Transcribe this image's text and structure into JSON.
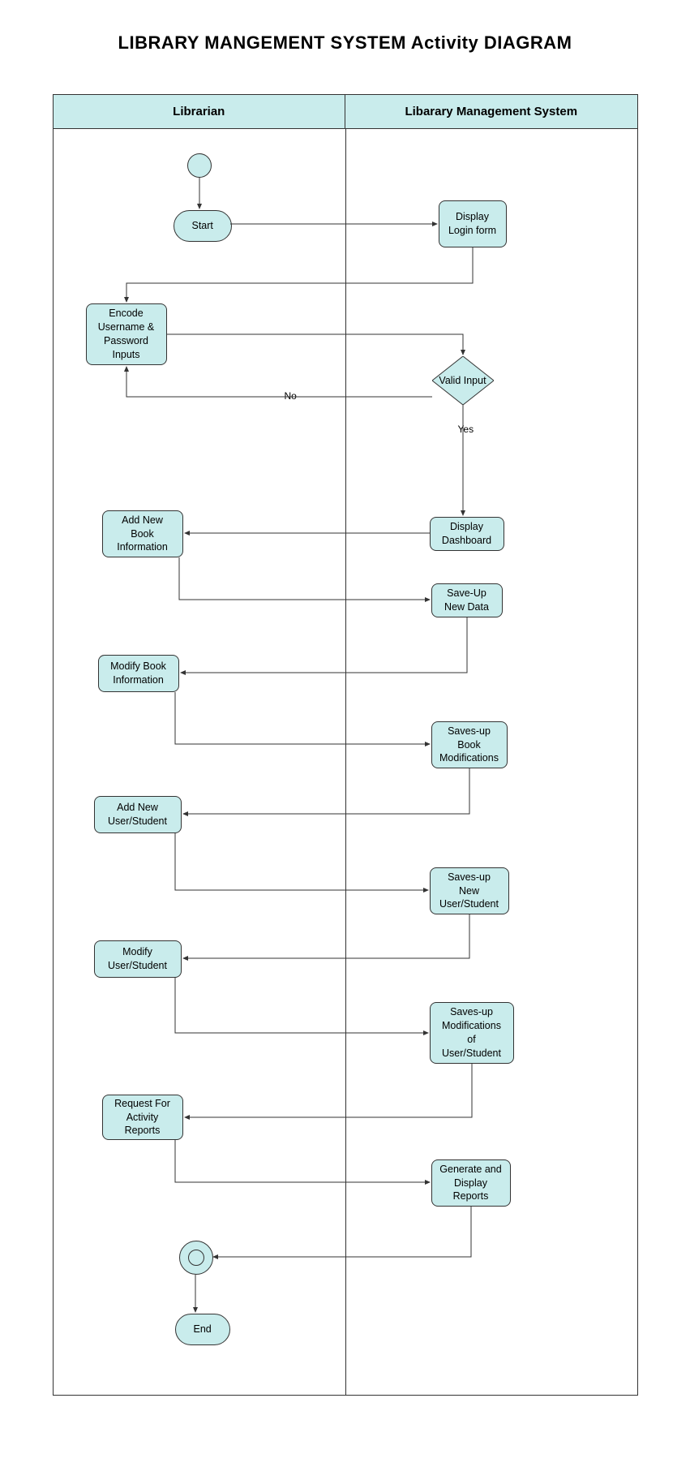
{
  "title": "LIBRARY MANGEMENT SYSTEM Activity DIAGRAM",
  "lanes": {
    "left": "Librarian",
    "right": "Libarary Management System"
  },
  "nodes": {
    "start": "Start",
    "encode": "Encode Username & Password Inputs",
    "addBook": "Add New Book Information",
    "modifyBook": "Modify Book Information",
    "addUser": "Add New User/Student",
    "modifyUser": "Modify User/Student",
    "reqReports": "Request For Activity Reports",
    "end": "End",
    "displayLogin": "Display Login form",
    "validInput": "Valid Input",
    "displayDash": "Display Dashboard",
    "saveNewData": "Save-Up New Data",
    "saveBookMod": "Saves-up Book Modifications",
    "saveNewUser": "Saves-up New User/Student",
    "saveUserMod": "Saves-up Modifications of User/Student",
    "genReports": "Generate and Display Reports"
  },
  "edgeLabels": {
    "no": "No",
    "yes": "Yes"
  }
}
